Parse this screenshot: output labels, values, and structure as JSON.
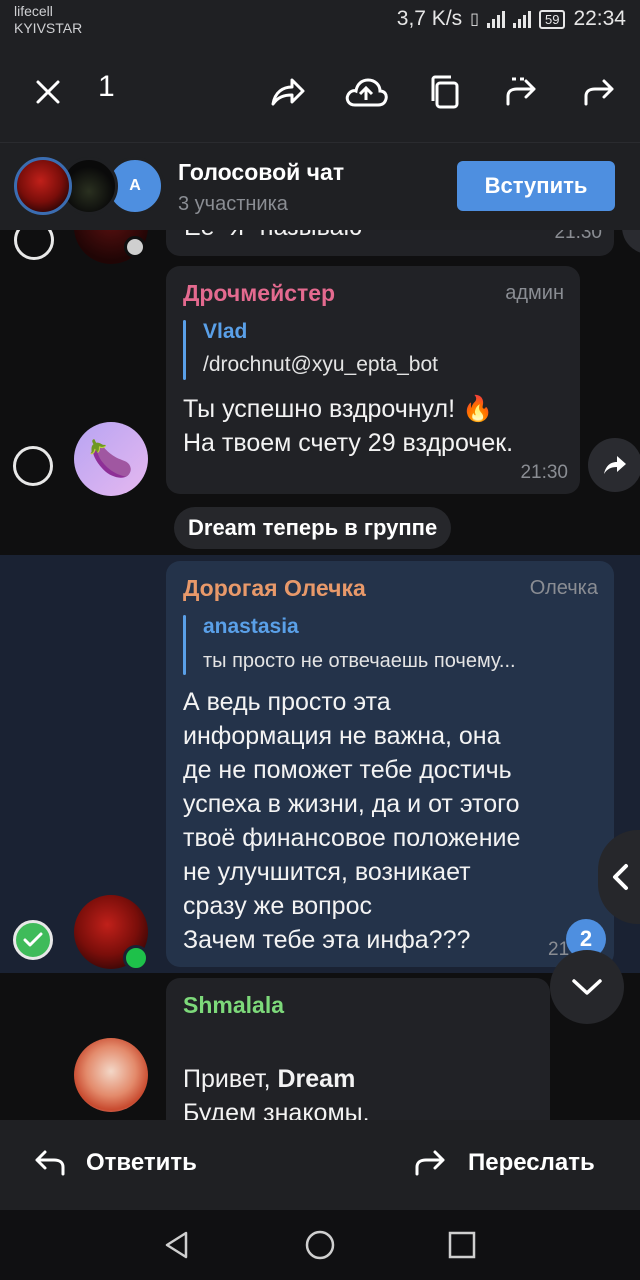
{
  "status": {
    "carrier1": "lifecell",
    "carrier2": "KYIVSTAR",
    "speed": "3,7 K/s",
    "battery": "59",
    "time": "22:34"
  },
  "header": {
    "selected_count": "1"
  },
  "voice_chat": {
    "title": "Голосовой чат",
    "participants": "3 участника",
    "join_label": "Вступить",
    "avatar_letter": "A"
  },
  "messages": [
    {
      "text": "Ее \"я\" называю",
      "time": "21:30"
    },
    {
      "sender": "Дрочмейстер",
      "sender_color": "#e46a8f",
      "role": "админ",
      "reply_name": "Vlad",
      "reply_text": "/drochnut@xyu_epta_bot",
      "text": "Ты успешно вздрочнул! 🔥\nНа твоем счету 29 вздрочек.",
      "time": "21:30"
    },
    {
      "sender": "Дорогая Олечка",
      "sender_color": "#e8996a",
      "role": "Олечка",
      "reply_name": "anastasia",
      "reply_text": "ты просто не отвечаешь почему...",
      "text": "А ведь просто эта\nинформация не важна, она\nде не поможет тебе достичь\nуспеха в жизни, да и от этого\nтвоё финансовое положение\nне улучшится, возникает\nсразу же вопрос\nЗачем тебе эта инфа???",
      "time": "21",
      "unread": "2"
    },
    {
      "sender": "Shmalala",
      "sender_color": "#7dd97a",
      "text_prefix": "Привет, ",
      "text_bold": "Dream",
      "text2": "Будем знакомы."
    }
  ],
  "service": {
    "joined": "Dream теперь в группе"
  },
  "actions": {
    "reply_label": "Ответить",
    "forward_label": "Переслать"
  }
}
